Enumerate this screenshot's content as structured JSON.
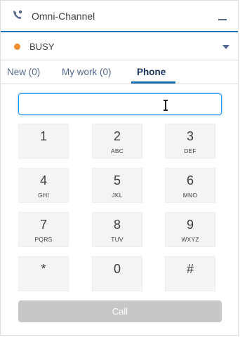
{
  "header": {
    "title": "Omni-Channel"
  },
  "status": {
    "label": "BUSY",
    "color": "#ef8e32"
  },
  "tabs": [
    {
      "label": "New (0)"
    },
    {
      "label": "My work (0)"
    },
    {
      "label": "Phone",
      "active": true
    }
  ],
  "dialer": {
    "input_value": "",
    "keys": [
      {
        "digit": "1",
        "letters": ""
      },
      {
        "digit": "2",
        "letters": "ABC"
      },
      {
        "digit": "3",
        "letters": "DEF"
      },
      {
        "digit": "4",
        "letters": "GHI"
      },
      {
        "digit": "5",
        "letters": "JKL"
      },
      {
        "digit": "6",
        "letters": "MNO"
      },
      {
        "digit": "7",
        "letters": "PQRS"
      },
      {
        "digit": "8",
        "letters": "TUV"
      },
      {
        "digit": "9",
        "letters": "WXYZ"
      },
      {
        "digit": "*",
        "letters": ""
      },
      {
        "digit": "0",
        "letters": ""
      },
      {
        "digit": "#",
        "letters": ""
      }
    ],
    "call_label": "Call"
  },
  "icons": {
    "header": "phone-handset-icon",
    "minimize": "minimize-icon",
    "status_caret": "chevron-down-icon",
    "cursor": "text-cursor-icon"
  }
}
